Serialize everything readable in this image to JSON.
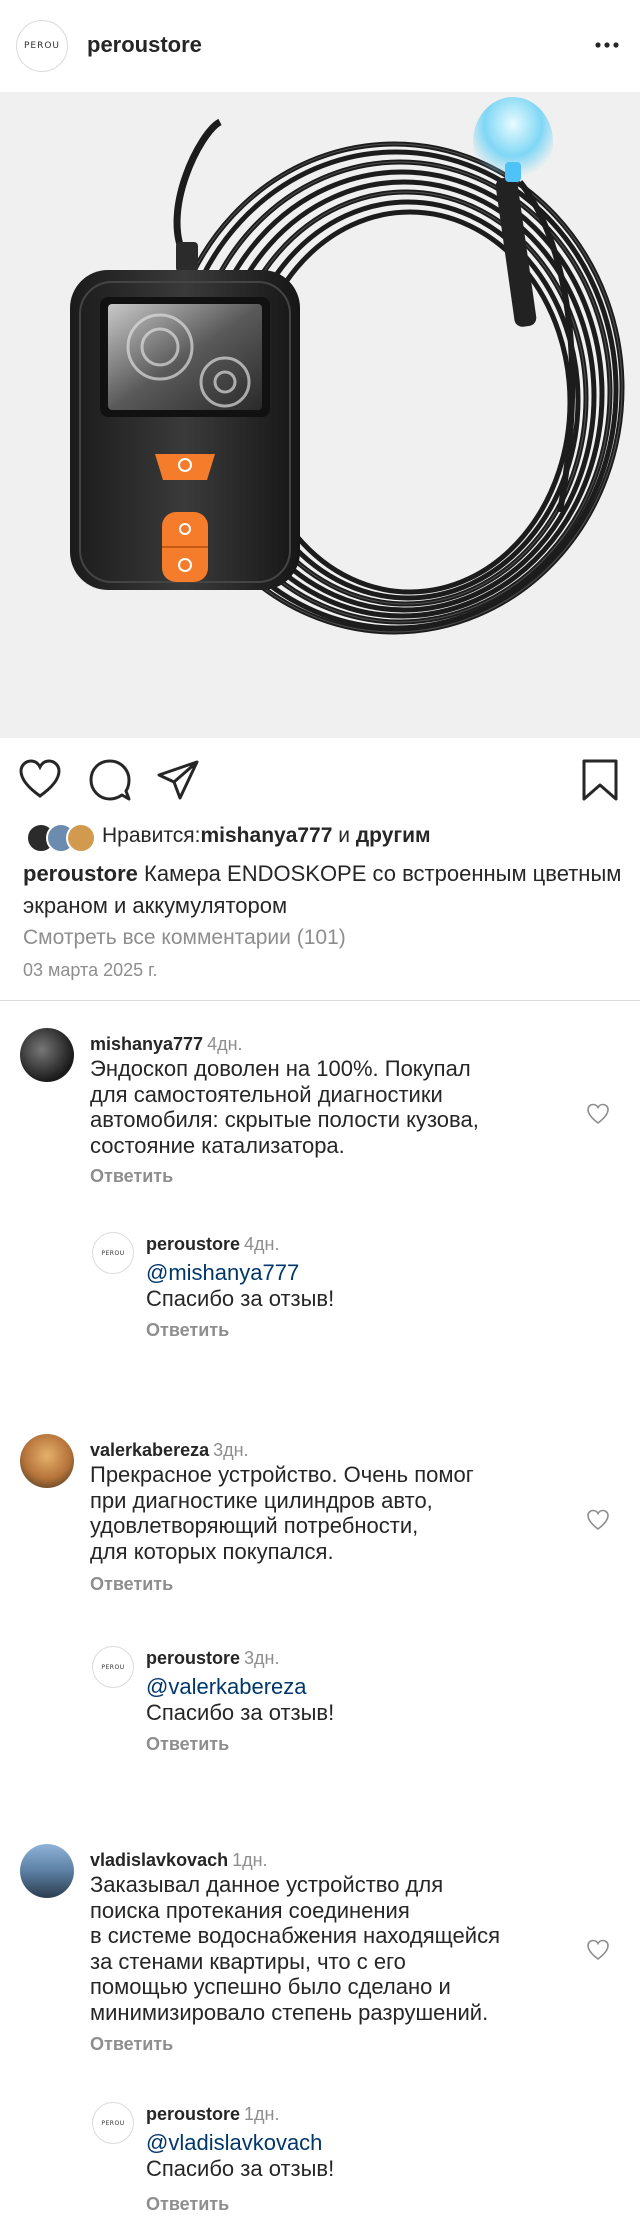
{
  "header": {
    "logo_text": "PEROU",
    "username": "peroustore"
  },
  "post": {
    "image_icon": "endoscope-product-photo",
    "likes_prefix": "Нравится: ",
    "likes_user": "mishanya777",
    "likes_and": " и ",
    "likes_others": "другим",
    "caption_user": "peroustore",
    "caption_text": " Камера ENDOSKOPE со встроенным цветным экраном и аккумулятором",
    "view_all": "Смотреть все комментарии (101)",
    "date": "03 марта 2025 г."
  },
  "comments": [
    {
      "user": "mishanya777",
      "time": "4дн.",
      "lines": [
        "Эндоскоп доволен на 100%. Покупал",
        "для самостоятельной диагностики",
        "автомобиля: скрытые полости кузова,",
        "состояние катализатора."
      ],
      "reply_label": "Ответить",
      "store_reply": {
        "user": "peroustore",
        "time": "4дн.",
        "mention": "@mishanya777",
        "text": "Спасибо за отзыв!",
        "reply_label": "Ответить"
      }
    },
    {
      "user": "valerkabereza",
      "time": "3дн.",
      "lines": [
        "Прекрасное устройство. Очень помог",
        "при диагностике цилиндров авто,",
        "удовлетворяющий потребности,",
        "для которых покупался."
      ],
      "reply_label": "Ответить",
      "store_reply": {
        "user": "peroustore",
        "time": "3дн.",
        "mention": "@valerkabereza",
        "text": "Спасибо за отзыв!",
        "reply_label": "Ответить"
      }
    },
    {
      "user": "vladislavkovach",
      "time": "1дн.",
      "lines": [
        "Заказывал данное устройство для",
        "поиска протекания соединения",
        "в системе водоснабжения находящейся",
        "за стенами квартиры, что с его",
        "помощью успешно было сделано и",
        "минимизировало степень разрушений."
      ],
      "reply_label": "Ответить",
      "store_reply": {
        "user": "peroustore",
        "time": "1дн.",
        "mention": "@vladislavkovach",
        "text": "Спасибо за отзыв!",
        "reply_label": "Ответить"
      }
    }
  ],
  "store_logo_text": "PEROU"
}
